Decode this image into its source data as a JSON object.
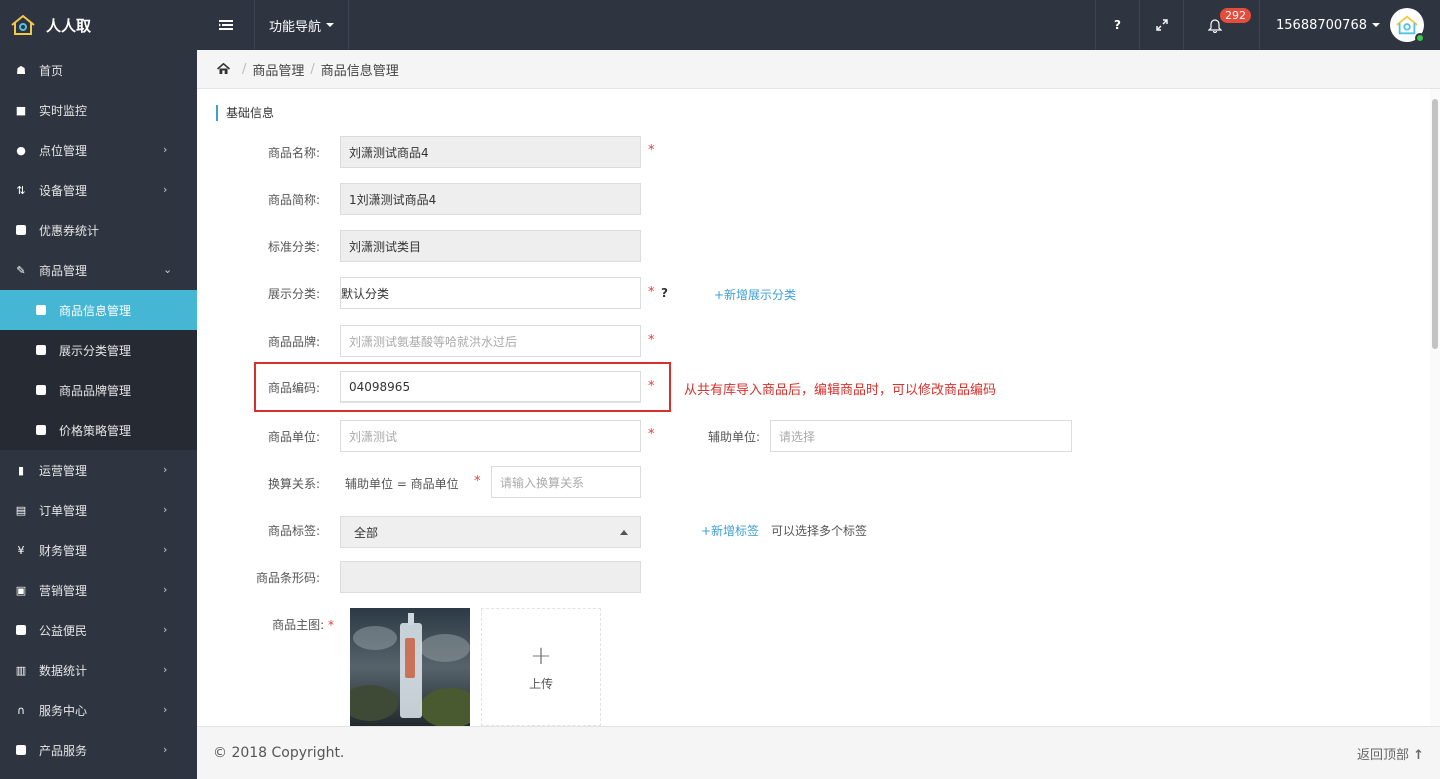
{
  "app": {
    "name": "人人取"
  },
  "topbar": {
    "nav_menu_label": "功能导航",
    "help_label": "?",
    "notification_count": "292",
    "username": "15688700768"
  },
  "sidebar": {
    "items": [
      {
        "label": "首页",
        "icon": "home-icon",
        "chevron": ""
      },
      {
        "label": "实时监控",
        "icon": "video-camera-icon",
        "chevron": ""
      },
      {
        "label": "点位管理",
        "icon": "map-marker-icon",
        "chevron": "›"
      },
      {
        "label": "设备管理",
        "icon": "device-sort-icon",
        "chevron": "›"
      },
      {
        "label": "优惠券统计",
        "icon": "square-icon",
        "chevron": ""
      },
      {
        "label": "商品管理",
        "icon": "edit-icon",
        "chevron": "⌄"
      },
      {
        "label": "商品信息管理",
        "icon": "square-icon",
        "chevron": "",
        "sub": true,
        "active": true
      },
      {
        "label": "展示分类管理",
        "icon": "square-icon",
        "chevron": "",
        "sub": true
      },
      {
        "label": "商品品牌管理",
        "icon": "square-icon",
        "chevron": "",
        "sub": true
      },
      {
        "label": "价格策略管理",
        "icon": "square-icon",
        "chevron": "",
        "sub": true
      },
      {
        "label": "运营管理",
        "icon": "bookmark-icon",
        "chevron": "›"
      },
      {
        "label": "订单管理",
        "icon": "list-icon",
        "chevron": "›"
      },
      {
        "label": "财务管理",
        "icon": "yen-icon",
        "chevron": "›"
      },
      {
        "label": "营销管理",
        "icon": "gift-icon",
        "chevron": "›"
      },
      {
        "label": "公益便民",
        "icon": "square-icon",
        "chevron": "›"
      },
      {
        "label": "数据统计",
        "icon": "bar-chart-icon",
        "chevron": "›"
      },
      {
        "label": "服务中心",
        "icon": "headset-icon",
        "chevron": "›"
      },
      {
        "label": "产品服务",
        "icon": "square-icon",
        "chevron": "›"
      }
    ]
  },
  "breadcrumb": {
    "items": [
      "商品管理",
      "商品信息管理"
    ]
  },
  "form": {
    "section_title": "基础信息",
    "name": {
      "label": "商品名称:",
      "value": "刘潇测试商品4"
    },
    "short_name": {
      "label": "商品简称:",
      "value": "1刘潇测试商品4"
    },
    "std_category": {
      "label": "标准分类:",
      "value": "刘潇测试类目"
    },
    "display_category": {
      "label": "展示分类:",
      "value": "默认分类",
      "help": "?",
      "add_link": "+新增展示分类"
    },
    "brand": {
      "label": "商品品牌:",
      "placeholder": "刘潇测试氨基酸等哈就洪水过后"
    },
    "code": {
      "label": "商品编码:",
      "value": "04098965"
    },
    "annotation": "从共有库导入商品后，编辑商品时，可以修改商品编码",
    "unit": {
      "label": "商品单位:",
      "placeholder": "刘潇测试"
    },
    "aux_unit": {
      "label": "辅助单位:",
      "placeholder": "请选择"
    },
    "conversion": {
      "label": "换算关系:",
      "formula": "辅助单位 = 商品单位",
      "placeholder": "请输入换算关系"
    },
    "tags": {
      "label": "商品标签:",
      "value": "全部",
      "add_link": "+新增标签",
      "hint": "可以选择多个标签"
    },
    "barcode": {
      "label": "商品条形码:",
      "value": ""
    },
    "main_image": {
      "label": "商品主图:",
      "upload_label": "上传"
    },
    "required_mark": "*"
  },
  "footer": {
    "copyright": "© 2018 Copyright.",
    "back_to_top": "返回顶部"
  },
  "colors": {
    "sidebar_bg": "#2f3540",
    "accent": "#45b6d4",
    "link": "#3f9fd5",
    "required": "#e23b3b",
    "annotation": "#d9302c"
  }
}
